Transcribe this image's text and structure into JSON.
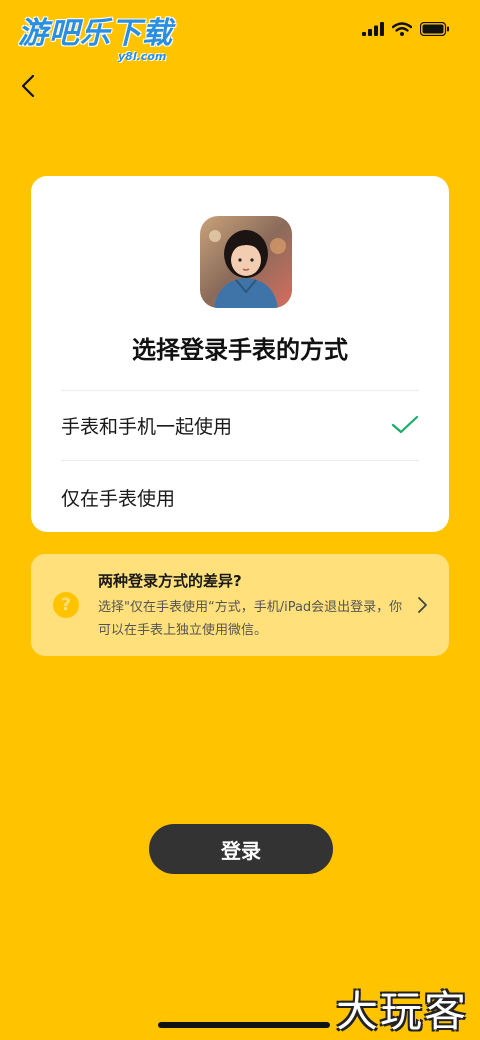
{
  "watermark": {
    "main": "游吧乐下载",
    "sub": "y8l.com",
    "corner": "大玩客"
  },
  "status_bar": {
    "icons": [
      "signal-icon",
      "wifi-icon",
      "battery-icon"
    ]
  },
  "nav": {
    "back_icon": "chevron-left-icon"
  },
  "card": {
    "title": "选择登录手表的方式",
    "options": [
      {
        "label": "手表和手机一起使用",
        "selected": true
      },
      {
        "label": "仅在手表使用",
        "selected": false
      }
    ]
  },
  "info": {
    "title": "两种登录方式的差异?",
    "body": "选择\"仅在手表使用“方式，手机/iPad会退出登录，你可以在手表上独立使用微信。",
    "icon": "question-icon"
  },
  "login_button": {
    "label": "登录"
  },
  "colors": {
    "background": "#FFC300",
    "accent_check": "#1AAD6A",
    "button_bg": "#333333",
    "info_bg": "#FFE07A"
  }
}
